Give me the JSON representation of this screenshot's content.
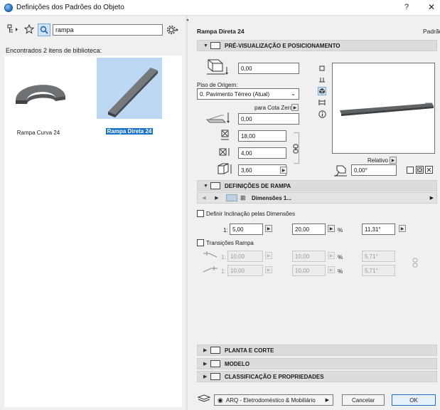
{
  "window": {
    "title": "Definições dos Padrões do Objeto",
    "help": "?",
    "close": "✕"
  },
  "library": {
    "search_value": "rampa",
    "found_text": "Encontrados 2 itens de biblioteca:",
    "items": [
      {
        "label": "Rampa Curva 24"
      },
      {
        "label": "Rampa Direta 24"
      }
    ]
  },
  "object": {
    "title": "Rampa Direta 24",
    "default_label": "Padrão"
  },
  "sections": {
    "preview": "PRÉ-VISUALIZAÇÃO E POSICIONAMENTO",
    "ramp": "DEFINIÇÕES DE RAMPA",
    "plan": "PLANTA E CORTE",
    "model": "MODELO",
    "classification": "CLASSIFICAÇÃO E PROPRIEDADES"
  },
  "placement": {
    "elevation": "0,00",
    "origin_label": "Piso de Origem:",
    "origin_value": "0. Pavimento Térreo (Atual)",
    "cota_label": "para Cota Zero",
    "cota_value": "0,00",
    "width": "18,00",
    "length": "4,00",
    "height": "3,60",
    "relative_label": "Relativo",
    "angle": "0,00°"
  },
  "ramp": {
    "tab_label": "Dimensões 1...",
    "slope_label": "Definir Inclinação pelas Dimensões",
    "ratio_prefix": "1:",
    "ratio_value": "5,00",
    "percent_value": "20,00",
    "percent_unit": "%",
    "angle_value": "11,31°",
    "transitions_label": "Transições Rampa",
    "t1_ratio": "10,00",
    "t1_percent": "10,00",
    "t1_angle": "5,71°",
    "t2_ratio": "10,00",
    "t2_percent": "10,00",
    "t2_angle": "5,71°"
  },
  "footer": {
    "layer": "ARQ - Eletrodoméstico & Mobiliário",
    "cancel": "Cancelar",
    "ok": "OK"
  },
  "colors": {
    "accent": "#1a73c8",
    "selected_bg": "#bcd8f2"
  }
}
